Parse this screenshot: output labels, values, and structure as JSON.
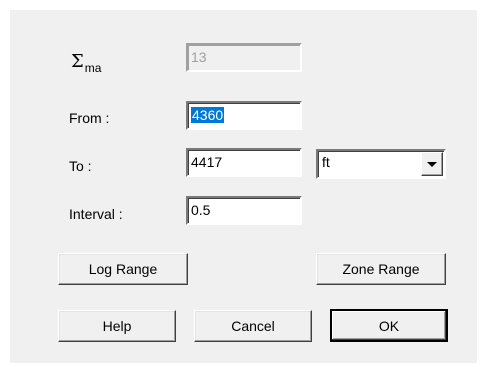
{
  "sigma": {
    "symbol": "Σ",
    "subscript": "ma",
    "value": "13"
  },
  "from": {
    "label": "From :",
    "value": "4360"
  },
  "to": {
    "label": "To :",
    "value": "4417"
  },
  "interval": {
    "label": "Interval :",
    "value": "0.5"
  },
  "unit": {
    "selected": "ft",
    "icon": "dropdown-arrow-icon"
  },
  "buttons": {
    "log_range": "Log Range",
    "zone_range": "Zone Range",
    "help": "Help",
    "cancel": "Cancel",
    "ok": "OK"
  }
}
